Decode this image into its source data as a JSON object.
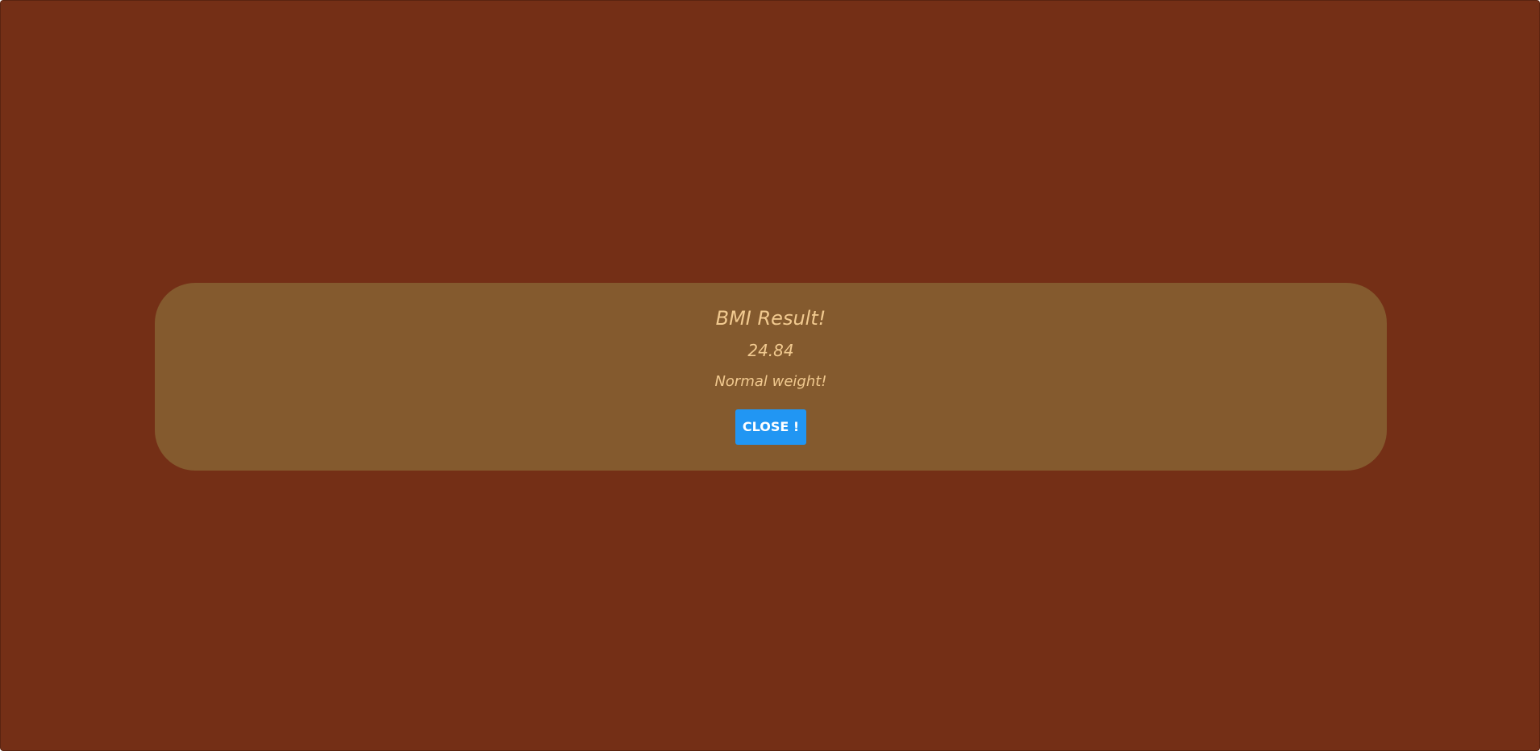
{
  "colors": {
    "page_background": "#742f16",
    "card_background": "#845a2e",
    "text": "#f1c98f",
    "button_background": "#2196f3",
    "button_text": "#ffffff"
  },
  "result": {
    "title": "BMI Result!",
    "bmi_value": "24.84",
    "status": "Normal weight!",
    "close_label": "CLOSE !"
  }
}
